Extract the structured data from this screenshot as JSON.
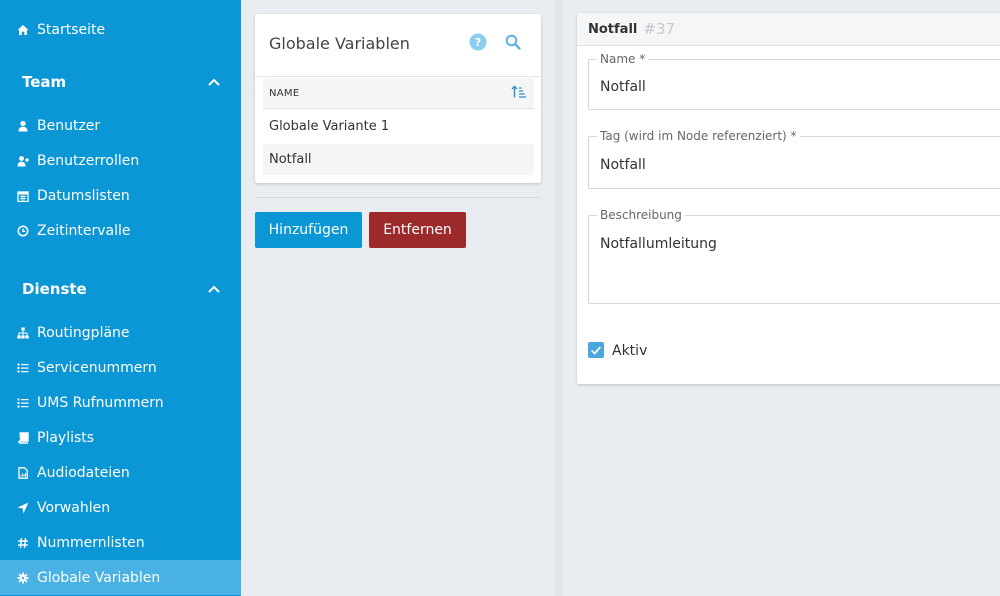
{
  "sidebar": {
    "home": {
      "label": "Startseite",
      "icon": "home-icon"
    },
    "team": {
      "title": "Team",
      "items": [
        {
          "label": "Benutzer",
          "icon": "user-icon"
        },
        {
          "label": "Benutzerrollen",
          "icon": "user-plus-icon"
        },
        {
          "label": "Datumslisten",
          "icon": "calendar-icon"
        },
        {
          "label": "Zeitintervalle",
          "icon": "clock-icon"
        }
      ]
    },
    "dienste": {
      "title": "Dienste",
      "items": [
        {
          "label": "Routingpläne",
          "icon": "sitemap-icon"
        },
        {
          "label": "Servicenummern",
          "icon": "list-icon"
        },
        {
          "label": "UMS Rufnummern",
          "icon": "list-icon"
        },
        {
          "label": "Playlists",
          "icon": "book-icon"
        },
        {
          "label": "Audiodateien",
          "icon": "audio-file-icon"
        },
        {
          "label": "Vorwahlen",
          "icon": "location-arrow-icon"
        },
        {
          "label": "Nummernlisten",
          "icon": "hashtag-icon"
        },
        {
          "label": "Globale Variablen",
          "icon": "gear-icon",
          "active": true
        }
      ]
    },
    "accent": "#0b96d6",
    "active_bg": "#49b1e3"
  },
  "list_panel": {
    "title": "Globale Variablen",
    "column_header": "NAME",
    "rows": [
      "Globale Variante 1",
      "Notfall"
    ],
    "selected_row": "Notfall",
    "add_label": "Hinzufügen",
    "remove_label": "Entfernen",
    "add_color": "#0b96d6",
    "remove_color": "#9d2a2a"
  },
  "detail": {
    "name": "Notfall",
    "id": "#37",
    "fields": {
      "name_label": "Name  *",
      "name_value": "Notfall",
      "tag_label": "Tag (wird im Node referenziert)  *",
      "tag_value": "Notfall",
      "desc_label": "Beschreibung",
      "desc_value": "Notfallumleitung"
    },
    "active_label": "Aktiv",
    "active_checked": true
  }
}
